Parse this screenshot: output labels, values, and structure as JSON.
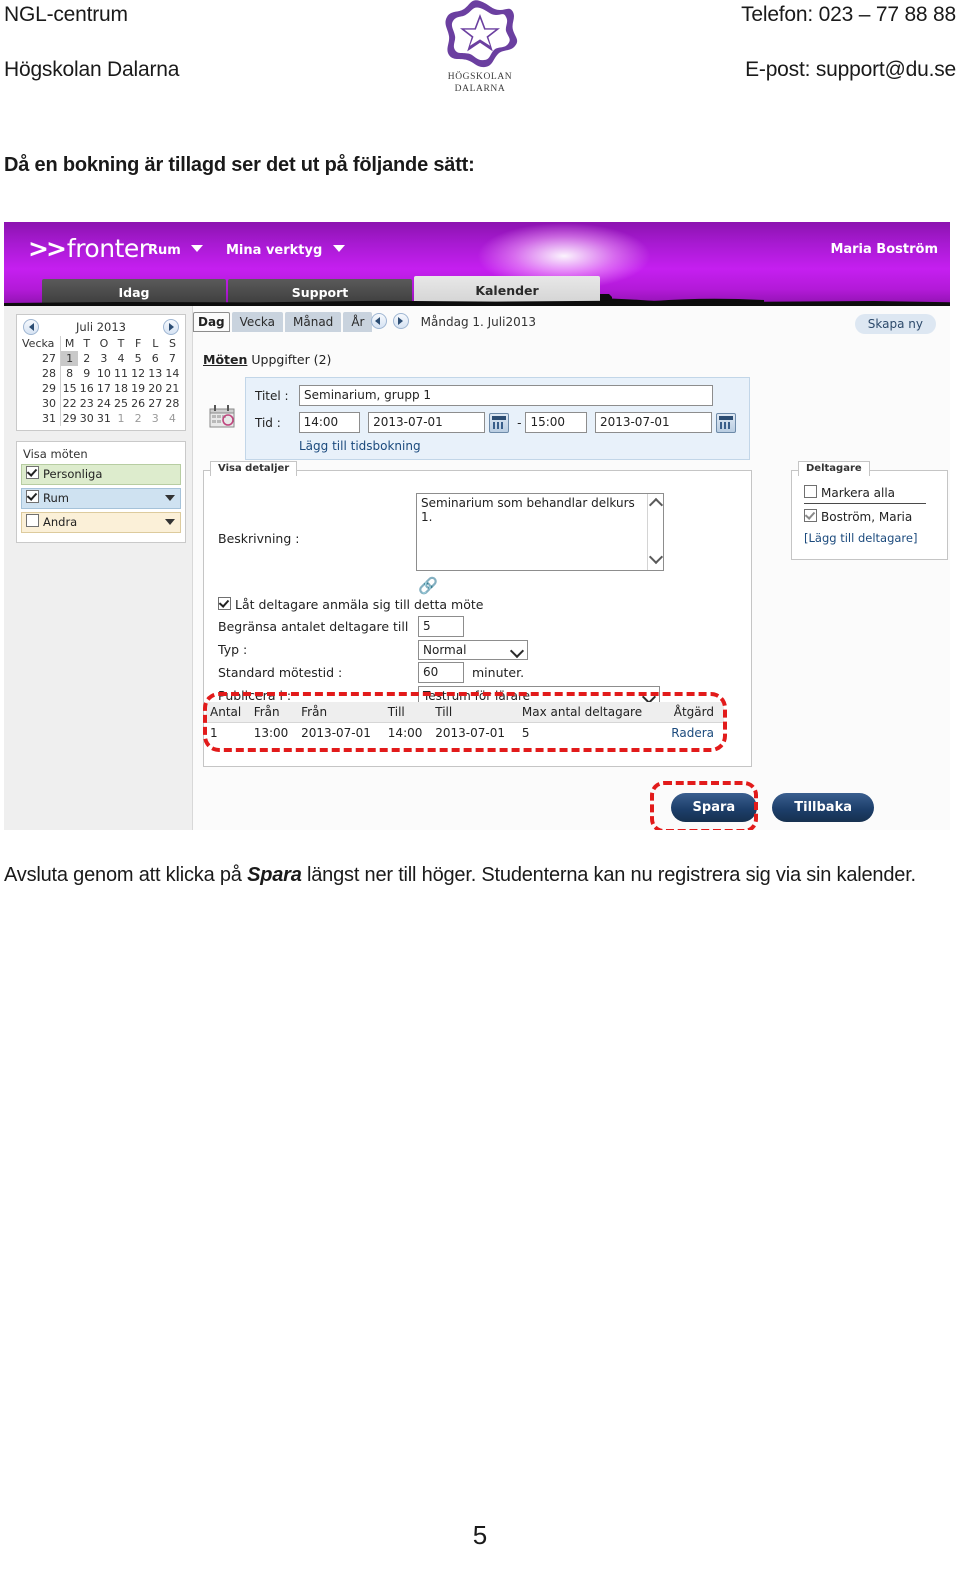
{
  "doc": {
    "header": {
      "left_line1": "NGL-centrum",
      "left_line2": "Högskolan Dalarna",
      "right_line1": "Telefon: 023 – 77 88 88",
      "right_line2": "E-post: support@du.se",
      "logo_line1": "HÖGSKOLAN",
      "logo_line2": "DALARNA",
      "logo_icon": "star-in-flower-logo"
    },
    "intro": "Då en bokning är tillagd ser det ut på följande sätt:",
    "closing_part1": "Avsluta genom att klicka på ",
    "closing_emph": "Spara",
    "closing_part2": " längst ner till höger.  Studenterna kan nu registrera sig via sin kalender.",
    "page_number": "5"
  },
  "screenshot": {
    "banner": {
      "brand_chevrons": ">>",
      "brand_word": "fronter",
      "menu": [
        "Rum",
        "Mina verktyg"
      ],
      "user": "Maria Boström",
      "accent_color": "#c51ff0"
    },
    "tabs": [
      {
        "label": "Idag",
        "active": false
      },
      {
        "label": "Support",
        "active": false
      },
      {
        "label": "Kalender",
        "active": true
      }
    ],
    "minicalendar": {
      "title": "Juli 2013",
      "week_header": "Vecka",
      "day_headers": [
        "M",
        "T",
        "O",
        "T",
        "F",
        "L",
        "S"
      ],
      "rows": [
        {
          "week": "27",
          "days": [
            "1",
            "2",
            "3",
            "4",
            "5",
            "6",
            "7"
          ],
          "today_index": 0
        },
        {
          "week": "28",
          "days": [
            "8",
            "9",
            "10",
            "11",
            "12",
            "13",
            "14"
          ],
          "today_index": -1
        },
        {
          "week": "29",
          "days": [
            "15",
            "16",
            "17",
            "18",
            "19",
            "20",
            "21"
          ],
          "today_index": -1
        },
        {
          "week": "30",
          "days": [
            "22",
            "23",
            "24",
            "25",
            "26",
            "27",
            "28"
          ],
          "today_index": -1
        },
        {
          "week": "31",
          "days": [
            "29",
            "30",
            "31",
            "1",
            "2",
            "3",
            "4"
          ],
          "today_index": -1
        }
      ],
      "prev_icon": "chevron-left-icon",
      "next_icon": "chevron-right-icon"
    },
    "visa_moten": {
      "title": "Visa möten",
      "items": [
        {
          "label": "Personliga",
          "checked": true,
          "has_caret": false,
          "tone": "green"
        },
        {
          "label": "Rum",
          "checked": true,
          "has_caret": true,
          "tone": "blue"
        },
        {
          "label": "Andra",
          "checked": false,
          "has_caret": true,
          "tone": "beige"
        }
      ]
    },
    "viewbar": {
      "views": [
        {
          "label": "Dag",
          "selected": true
        },
        {
          "label": "Vecka",
          "selected": false
        },
        {
          "label": "Månad",
          "selected": false
        },
        {
          "label": "År",
          "selected": false
        }
      ],
      "current_day": "Måndag 1. Juli2013",
      "create_button": "Skapa ny"
    },
    "section_tabs": {
      "moten": "Möten",
      "uppgifter": "Uppgifter (2)"
    },
    "meeting": {
      "title_label": "Titel :",
      "title_value": "Seminarium, grupp 1",
      "time_label": "Tid :",
      "start_time": "14:00",
      "start_date": "2013-07-01",
      "separator": "-",
      "end_time": "15:00",
      "end_date": "2013-07-01",
      "add_booking_link": "Lägg till tidsbokning",
      "date_picker_icon": "calendar-picker-icon",
      "meeting_icon": "calendar-clock-icon"
    },
    "details": {
      "legend": "Visa detaljer",
      "description_label": "Beskrivning :",
      "description_value": "Seminarium som behandlar delkurs 1.",
      "link_icon": "chain-link-icon",
      "allow_signup_label": "Låt deltagare anmäla sig till detta möte",
      "allow_signup_checked": true,
      "limit_label": "Begränsa antalet deltagare till",
      "limit_value": "5",
      "type_label": "Typ :",
      "type_value": "Normal",
      "duration_label": "Standard mötestid :",
      "duration_value": "60",
      "duration_suffix": "minuter.",
      "publish_label": "Publicera i :",
      "publish_value": "Testrum för lärare"
    },
    "participants": {
      "legend": "Deltagare",
      "select_all_label": "Markera alla",
      "select_all_checked": false,
      "people": [
        {
          "name": "Boström, Maria",
          "checked": true
        }
      ],
      "add_link": "[Lägg till deltagare]"
    },
    "booking_table": {
      "headers": [
        "Antal",
        "Från",
        "Från",
        "Till",
        "Till",
        "Max antal deltagare",
        "Åtgärd"
      ],
      "rows": [
        [
          "1",
          "13:00",
          "2013-07-01",
          "14:00",
          "2013-07-01",
          "5",
          "Radera"
        ]
      ],
      "highlight_color": "#e21b1b"
    },
    "actions": {
      "save_label": "Spara",
      "back_label": "Tillbaka",
      "save_highlighted": true
    }
  }
}
